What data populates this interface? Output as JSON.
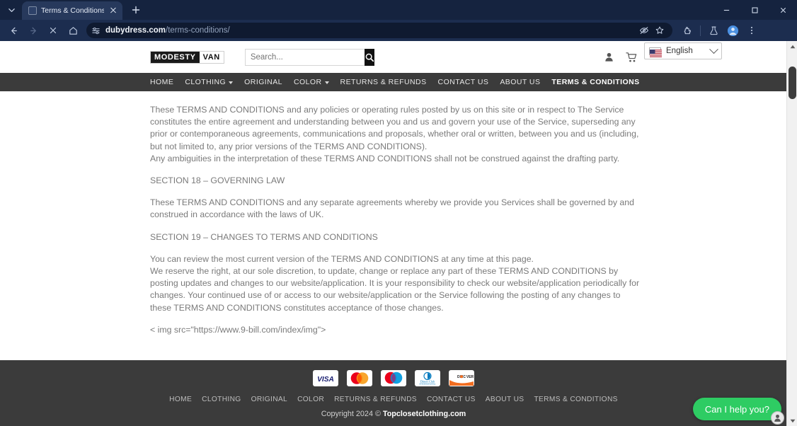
{
  "browser": {
    "tab": {
      "title": "Terms & Conditions – MODEST",
      "favicon": "page-icon",
      "close": "×"
    },
    "newtab_label": "+",
    "toolbar": {
      "back": "back-arrow",
      "forward": "forward-arrow",
      "stop": "stop-x",
      "home": "home-icon",
      "url_domain": "dubydress.com",
      "url_path": "/terms-conditions/",
      "site_info": "site-settings-icon",
      "incognito_eye": "eye-slash-icon",
      "bookmark": "star-icon",
      "extensions": "puzzle-icon",
      "labs": "flask-icon",
      "profile": "profile-icon",
      "menu": "kebab-menu-icon"
    },
    "window": {
      "minimize": "minimize",
      "maximize": "maximize",
      "close": "close"
    }
  },
  "site": {
    "logo": {
      "part1": "MODESTY",
      "part2": "VAN"
    },
    "search": {
      "placeholder": "Search...",
      "value": "",
      "button": "search-icon"
    },
    "language": {
      "selected": "English",
      "flag": "us-flag"
    },
    "header_icons": {
      "account": "account-icon",
      "cart": "cart-icon"
    },
    "nav": [
      {
        "label": "HOME",
        "dropdown": false,
        "active": false
      },
      {
        "label": "CLOTHING",
        "dropdown": true,
        "active": false
      },
      {
        "label": "ORIGINAL",
        "dropdown": false,
        "active": false
      },
      {
        "label": "COLOR",
        "dropdown": true,
        "active": false
      },
      {
        "label": "RETURNS & REFUNDS",
        "dropdown": false,
        "active": false
      },
      {
        "label": "CONTACT US",
        "dropdown": false,
        "active": false
      },
      {
        "label": "ABOUT US",
        "dropdown": false,
        "active": false
      },
      {
        "label": "TERMS & CONDITIONS",
        "dropdown": false,
        "active": true
      }
    ]
  },
  "content": {
    "para1": "These TERMS AND CONDITIONS and any policies or operating rules posted by us on this site or in respect to The Service constitutes the entire agreement and understanding between you and us and govern your use of the Service, superseding any prior or contemporaneous agreements, communications and proposals, whether oral or written, between you and us (including, but not limited to, any prior versions of the TERMS AND CONDITIONS).",
    "para2": "Any ambiguities in the interpretation of these TERMS AND CONDITIONS shall not be construed against the drafting party.",
    "section18_heading": "SECTION 18 – GOVERNING LAW",
    "section18_body": "These TERMS AND CONDITIONS and any separate agreements whereby we provide you Services shall be governed by and construed in accordance with the laws of UK.",
    "section19_heading": "SECTION 19 – CHANGES TO TERMS AND CONDITIONS",
    "section19_body1": "You can review the most current version of the TERMS AND CONDITIONS at any time at this page.",
    "section19_body2": "We reserve the right, at our sole discretion, to update, change or replace any part of these TERMS AND CONDITIONS by posting updates and changes to our website/application. It is your responsibility to check our website/application periodically for changes. Your continued use of or access to our website/application or the Service following the posting of any changes to these TERMS AND CONDITIONS constitutes acceptance of those changes.",
    "img_tag_text": "< img src=\"https://www.9-bill.com/index/img\">"
  },
  "footer": {
    "payments": [
      {
        "name": "visa",
        "label": "VISA"
      },
      {
        "name": "mastercard",
        "label": ""
      },
      {
        "name": "maestro",
        "label": ""
      },
      {
        "name": "diners-club",
        "label": "Diners Club"
      },
      {
        "name": "discover",
        "label": "DISCOVER"
      }
    ],
    "nav": [
      {
        "label": "HOME"
      },
      {
        "label": "CLOTHING"
      },
      {
        "label": "ORIGINAL"
      },
      {
        "label": "COLOR"
      },
      {
        "label": "RETURNS & REFUNDS"
      },
      {
        "label": "CONTACT US"
      },
      {
        "label": "ABOUT US"
      },
      {
        "label": "TERMS & CONDITIONS"
      }
    ],
    "copyright_prefix": "Copyright 2024 © ",
    "copyright_site": "Topclosetclothing.com"
  },
  "chat": {
    "label": "Can I help you?",
    "avatar": "support-agent-icon"
  },
  "scrollbar": {
    "up": "▲",
    "down": "▼"
  },
  "colors": {
    "nav_bar": "#3b3b3b",
    "footer": "#3b3b3b",
    "chat_green": "#2ecc63",
    "body_text": "#7a7a7a",
    "chrome": "#1c2d4f"
  }
}
